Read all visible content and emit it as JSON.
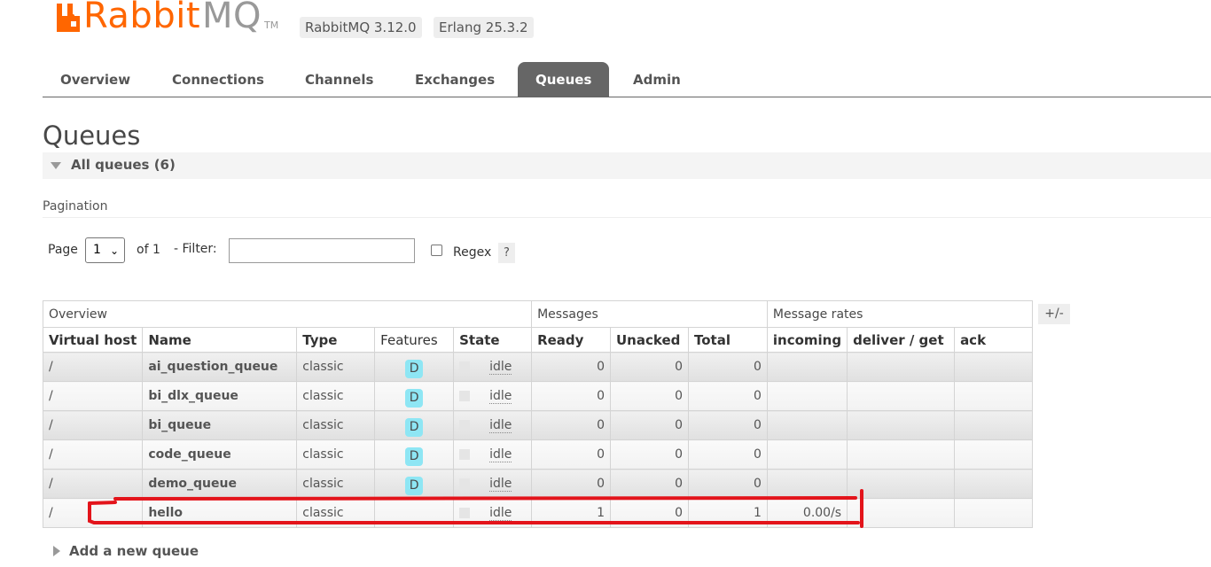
{
  "header": {
    "logo_rabbit": "Rabbit",
    "logo_mq": "MQ",
    "logo_tm": "TM",
    "version_rabbitmq": "RabbitMQ 3.12.0",
    "version_erlang": "Erlang 25.3.2",
    "brand_color": "#ff6600"
  },
  "nav": {
    "tabs": [
      {
        "label": "Overview",
        "active": false
      },
      {
        "label": "Connections",
        "active": false
      },
      {
        "label": "Channels",
        "active": false
      },
      {
        "label": "Exchanges",
        "active": false
      },
      {
        "label": "Queues",
        "active": true
      },
      {
        "label": "Admin",
        "active": false
      }
    ]
  },
  "page": {
    "title": "Queues",
    "section_title": "All queues (6)",
    "pagination_label": "Pagination",
    "page_label": "Page",
    "page_value": "1",
    "of_label": "of 1",
    "filter_label": "- Filter:",
    "filter_value": "",
    "regex_label": "Regex",
    "regex_checked": false,
    "help_label": "?",
    "columns_toggle": "+/-",
    "add_queue_label": "Add a new queue"
  },
  "table": {
    "groups": [
      "Overview",
      "Messages",
      "Message rates"
    ],
    "headers": [
      "Virtual host",
      "Name",
      "Type",
      "Features",
      "State",
      "Ready",
      "Unacked",
      "Total",
      "incoming",
      "deliver / get",
      "ack"
    ],
    "rows": [
      {
        "vhost": "/",
        "name": "ai_question_queue",
        "type": "classic",
        "feature": "D",
        "state": "idle",
        "ready": "0",
        "unacked": "0",
        "total": "0",
        "incoming": "",
        "deliver": "",
        "ack": ""
      },
      {
        "vhost": "/",
        "name": "bi_dlx_queue",
        "type": "classic",
        "feature": "D",
        "state": "idle",
        "ready": "0",
        "unacked": "0",
        "total": "0",
        "incoming": "",
        "deliver": "",
        "ack": ""
      },
      {
        "vhost": "/",
        "name": "bi_queue",
        "type": "classic",
        "feature": "D",
        "state": "idle",
        "ready": "0",
        "unacked": "0",
        "total": "0",
        "incoming": "",
        "deliver": "",
        "ack": ""
      },
      {
        "vhost": "/",
        "name": "code_queue",
        "type": "classic",
        "feature": "D",
        "state": "idle",
        "ready": "0",
        "unacked": "0",
        "total": "0",
        "incoming": "",
        "deliver": "",
        "ack": ""
      },
      {
        "vhost": "/",
        "name": "demo_queue",
        "type": "classic",
        "feature": "D",
        "state": "idle",
        "ready": "0",
        "unacked": "0",
        "total": "0",
        "incoming": "",
        "deliver": "",
        "ack": ""
      },
      {
        "vhost": "/",
        "name": "hello",
        "type": "classic",
        "feature": "",
        "state": "idle",
        "ready": "1",
        "unacked": "0",
        "total": "1",
        "incoming": "0.00/s",
        "deliver": "",
        "ack": ""
      }
    ]
  },
  "colors": {
    "feature_badge": "#8ee6f4",
    "active_tab": "#666666",
    "annotation": "#e3141b"
  }
}
